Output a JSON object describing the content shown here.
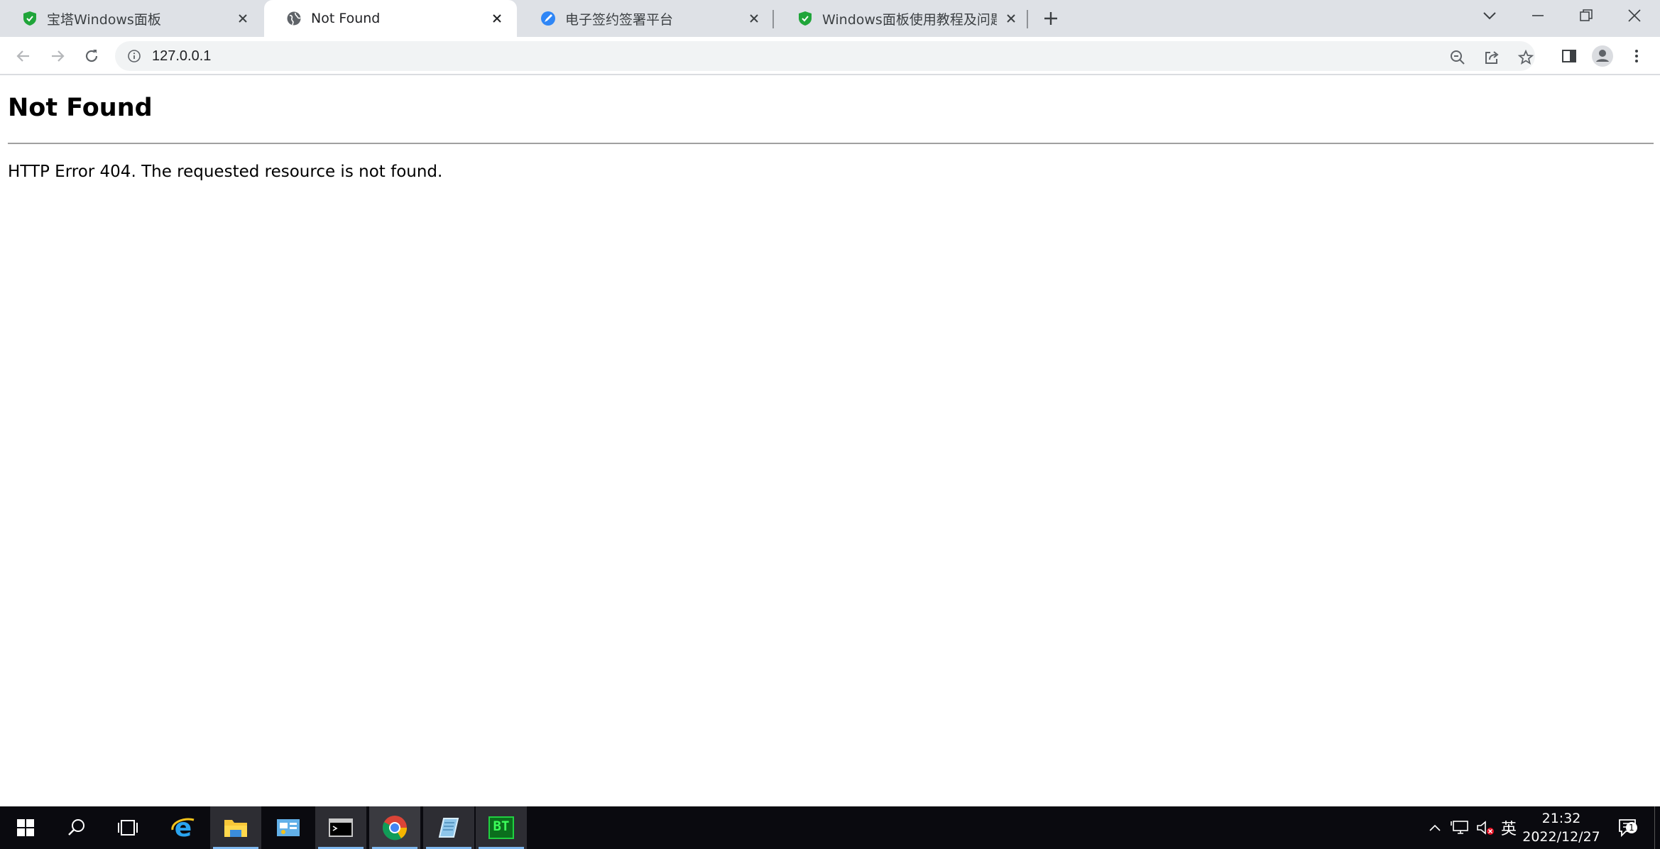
{
  "browser": {
    "tabs": [
      {
        "title": "宝塔Windows面板",
        "favicon": "bt-shield-icon",
        "active": false
      },
      {
        "title": "Not Found",
        "favicon": "globe-icon",
        "active": true
      },
      {
        "title": "电子签约签署平台",
        "favicon": "sign-app-icon",
        "active": false
      },
      {
        "title": "Windows面板使用教程及问题汇",
        "favicon": "bt-shield-icon",
        "active": false
      }
    ],
    "address": {
      "url": "127.0.0.1"
    },
    "accent_color": "#1a73e8",
    "tabstrip_color": "#dee1e6"
  },
  "page": {
    "heading": "Not Found",
    "message": "HTTP Error 404. The requested resource is not found."
  },
  "taskbar": {
    "apps": [
      "start-icon",
      "search-icon",
      "task-view-icon",
      "internet-explorer-icon",
      "file-explorer-icon",
      "control-panel-icon",
      "command-prompt-icon",
      "chrome-icon",
      "notepad-icon",
      "bt-panel-icon"
    ],
    "bt_label": "BT",
    "language": "英",
    "time": "21:32",
    "date": "2022/12/27",
    "notification_count": "1"
  }
}
